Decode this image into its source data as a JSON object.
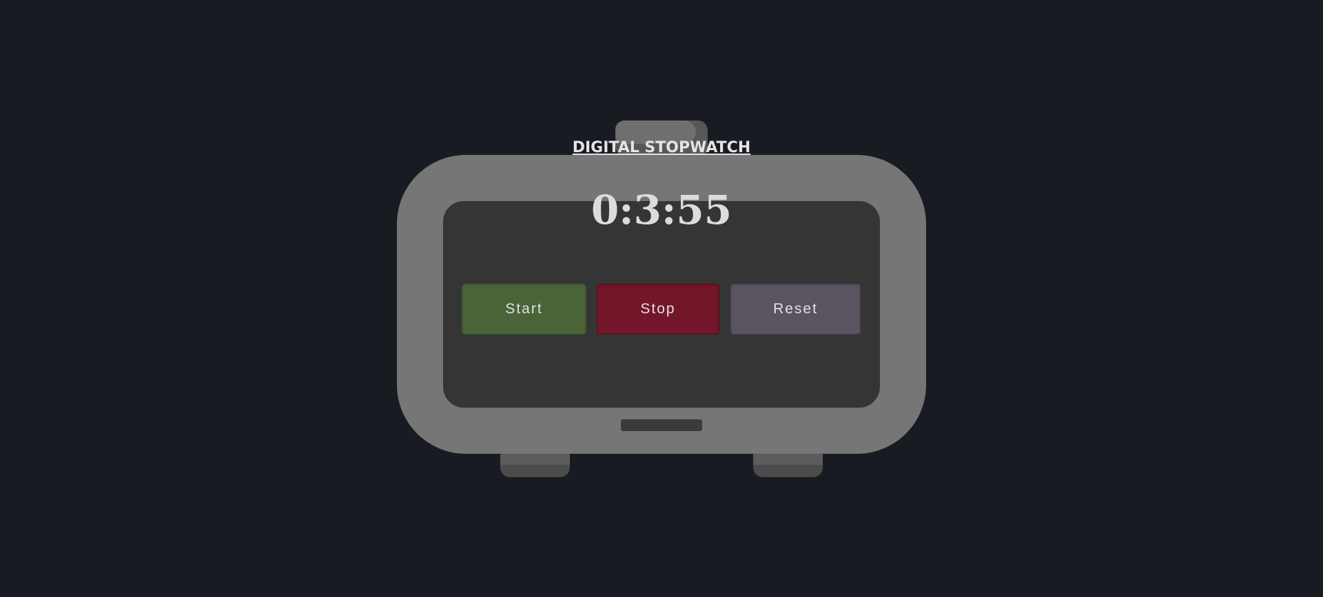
{
  "app": {
    "title": "DIGITAL STOPWATCH"
  },
  "display": {
    "time": "0:3:55"
  },
  "controls": {
    "start_label": "Start",
    "stop_label": "Stop",
    "reset_label": "Reset"
  },
  "colors": {
    "background": "#191b22",
    "device_body": "#767676",
    "screen": "#353535",
    "start_button": "#4a6438",
    "stop_button": "#74162a",
    "reset_button": "#5b5360",
    "text": "#e2e2e2"
  }
}
